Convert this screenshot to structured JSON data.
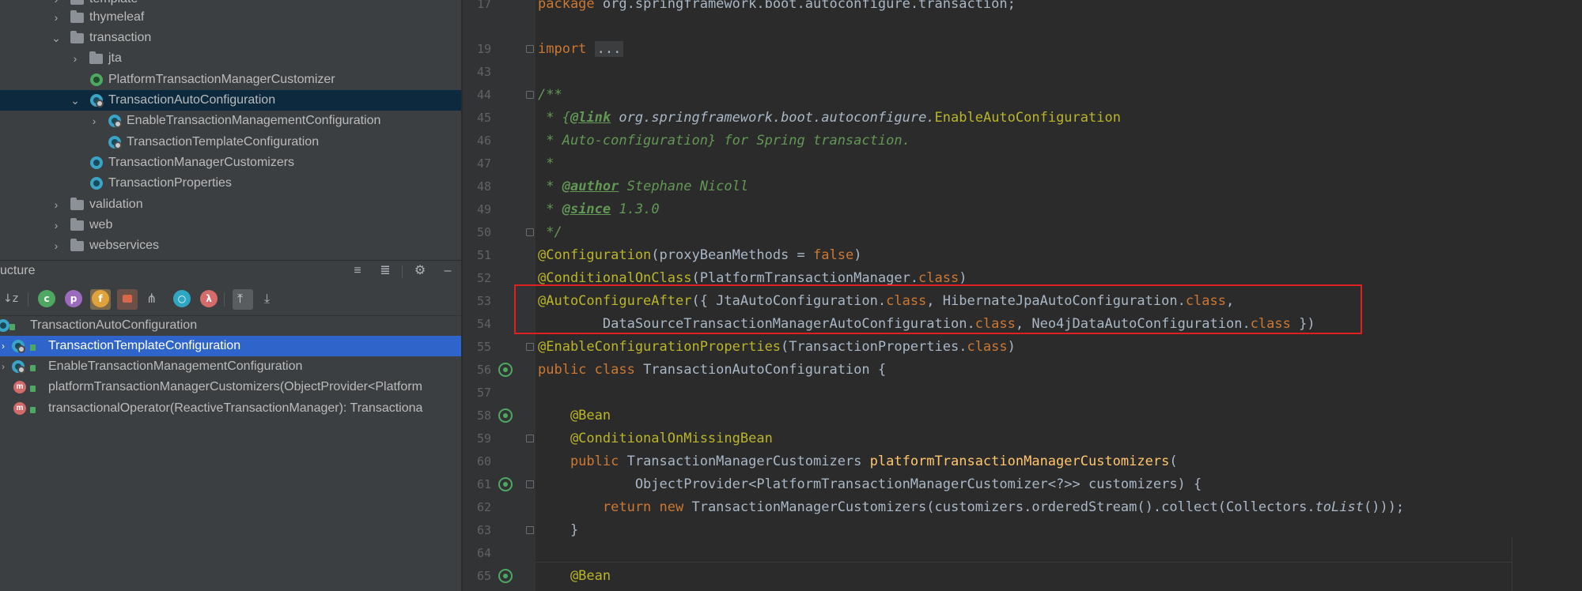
{
  "project_tree": {
    "items": [
      {
        "label": "template",
        "type": "folder"
      },
      {
        "label": "thymeleaf",
        "type": "folder"
      },
      {
        "label": "transaction",
        "type": "folder"
      },
      {
        "label": "jta",
        "type": "folder"
      },
      {
        "label": "PlatformTransactionManagerCustomizer",
        "type": "interface"
      },
      {
        "label": "TransactionAutoConfiguration",
        "type": "class"
      },
      {
        "label": "EnableTransactionManagementConfiguration",
        "type": "class"
      },
      {
        "label": "TransactionTemplateConfiguration",
        "type": "class"
      },
      {
        "label": "TransactionManagerCustomizers",
        "type": "class"
      },
      {
        "label": "TransactionProperties",
        "type": "class"
      },
      {
        "label": "validation",
        "type": "folder"
      },
      {
        "label": "web",
        "type": "folder"
      },
      {
        "label": "webservices",
        "type": "folder"
      }
    ]
  },
  "structure": {
    "title": "ucture",
    "toolbar_icons": [
      "sort-alpha-icon",
      "inherited-icon",
      "properties-icon",
      "fields-icon",
      "non-public-icon",
      "hierarchy-icon",
      "anonymous-icon",
      "lambda-icon",
      "autoscroll-to-source-icon",
      "autoscroll-from-source-icon"
    ],
    "root": "TransactionAutoConfiguration",
    "items": [
      {
        "label": "TransactionTemplateConfiguration",
        "kind": "class",
        "selected": true
      },
      {
        "label": "EnableTransactionManagementConfiguration",
        "kind": "class",
        "selected": false
      },
      {
        "label": "platformTransactionManagerCustomizers(ObjectProvider<Platform",
        "kind": "method",
        "selected": false
      },
      {
        "label": "transactionalOperator(ReactiveTransactionManager): Transactiona",
        "kind": "method",
        "selected": false
      }
    ]
  },
  "editor": {
    "line_numbers": [
      "17",
      "19",
      "43",
      "44",
      "45",
      "46",
      "47",
      "48",
      "49",
      "50",
      "51",
      "52",
      "53",
      "54",
      "55",
      "56",
      "57",
      "58",
      "59",
      "60",
      "61",
      "62",
      "63",
      "64",
      "65"
    ],
    "code": {
      "l17_kw": "package",
      "l17_rest": " org.springframework.boot.autoconfigure.transaction;",
      "l19_kw": "import",
      "l19_fold": "...",
      "l44": "/**",
      "l45_a": " * {",
      "l45_tag": "@link",
      "l45_b": " org.springframework.boot.autoconfigure.",
      "l45_c": "EnableAutoConfiguration",
      "l46": " * Auto-configuration} for Spring transaction.",
      "l47": " *",
      "l48_a": " * ",
      "l48_tag": "@author",
      "l48_b": " Stephane Nicoll",
      "l49_a": " * ",
      "l49_tag": "@since",
      "l49_b": " 1.3.0",
      "l50": " */",
      "l51_ann": "@Configuration",
      "l51_a": "(proxyBeanMethods = ",
      "l51_kw": "false",
      "l51_b": ")",
      "l52_ann": "@ConditionalOnClass",
      "l52_a": "(PlatformTransactionManager.",
      "l52_kw": "class",
      "l52_b": ")",
      "l53_ann": "@AutoConfigureAfter",
      "l53_a": "({ JtaAutoConfiguration.",
      "l53_kw1": "class",
      "l53_b": ", HibernateJpaAutoConfiguration.",
      "l53_kw2": "class",
      "l53_c": ",",
      "l54_a": "        DataSourceTransactionManagerAutoConfiguration.",
      "l54_kw1": "class",
      "l54_b": ", Neo4jDataAutoConfiguration.",
      "l54_kw2": "class",
      "l54_c": " })",
      "l55_ann": "@EnableConfigurationProperties",
      "l55_a": "(TransactionProperties.",
      "l55_kw": "class",
      "l55_b": ")",
      "l56_kw": "public class",
      "l56_a": " TransactionAutoConfiguration {",
      "l58_ann": "    @Bean",
      "l59_ann": "    @ConditionalOnMissingBean",
      "l60_kw": "    public",
      "l60_a": " TransactionManagerCustomizers ",
      "l60_fn": "platformTransactionManagerCustomizers",
      "l60_b": "(",
      "l61": "            ObjectProvider<PlatformTransactionManagerCustomizer<?>> customizers) {",
      "l62_kw": "        return new",
      "l62_a": " TransactionManagerCustomizers(customizers.orderedStream().collect(Collectors.",
      "l62_it": "toList",
      "l62_b": "()));",
      "l63": "    }",
      "l65_ann": "    @Bean"
    }
  },
  "colors": {
    "highlight_box": "#e02020",
    "selection": "#2f65ca",
    "tree_selection": "#0d293e"
  }
}
